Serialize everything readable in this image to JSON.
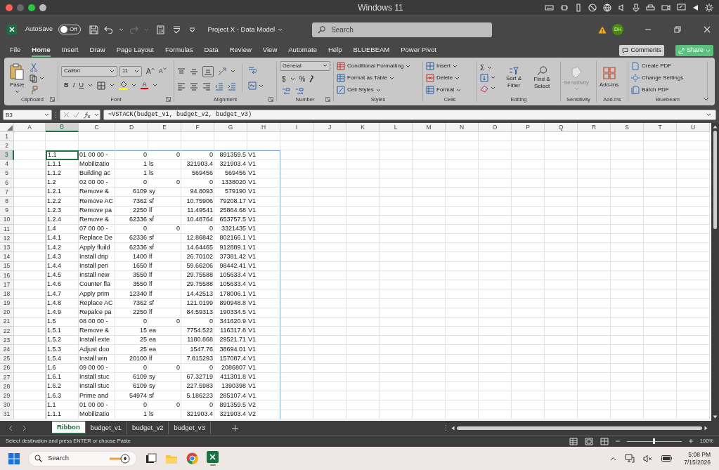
{
  "mac_bar": {
    "title": "Windows 11"
  },
  "title_bar": {
    "autosave_label": "AutoSave",
    "autosave_toggle": {
      "label": "Off",
      "on": false
    },
    "document_title": "Project X - Data Model",
    "search": {
      "placeholder": "Search"
    },
    "avatar": "DH"
  },
  "menu_tabs": [
    {
      "label": "File",
      "selected": false
    },
    {
      "label": "Home",
      "selected": true
    },
    {
      "label": "Insert",
      "selected": false
    },
    {
      "label": "Draw",
      "selected": false
    },
    {
      "label": "Page Layout",
      "selected": false
    },
    {
      "label": "Formulas",
      "selected": false
    },
    {
      "label": "Data",
      "selected": false
    },
    {
      "label": "Review",
      "selected": false
    },
    {
      "label": "View",
      "selected": false
    },
    {
      "label": "Automate",
      "selected": false
    },
    {
      "label": "Help",
      "selected": false
    },
    {
      "label": "BLUEBEAM",
      "selected": false
    },
    {
      "label": "Power Pivot",
      "selected": false
    }
  ],
  "comments_button": "Comments",
  "share_button": "Share",
  "ribbon": {
    "clipboard": {
      "paste": "Paste",
      "group": "Clipboard"
    },
    "font": {
      "font_name": "Calibri",
      "font_size": "11",
      "grow": "A",
      "shrink": "A",
      "bold": "B",
      "italic": "I",
      "underline": "U",
      "font_color": "A",
      "group": "Font"
    },
    "alignment": {
      "group": "Alignment"
    },
    "number": {
      "format": "General",
      "currency": "$",
      "percent": "%",
      "group": "Number"
    },
    "styles": {
      "items": [
        "Conditional Formatting",
        "Format as Table",
        "Cell Styles"
      ],
      "group": "Styles"
    },
    "cells": {
      "items": [
        "Insert",
        "Delete",
        "Format"
      ],
      "group": "Cells"
    },
    "editing": {
      "autosum": "Σ",
      "sort": "Sort & Filter",
      "find": "Find & Select",
      "group": "Editing"
    },
    "sensitivity": {
      "label": "Sensitivity",
      "disabled": true,
      "group": "Sensitivity"
    },
    "addins": {
      "label": "Add-ins",
      "group": "Add-ins"
    },
    "bluebeam": {
      "items": [
        "Create PDF",
        "Change Settings",
        "Batch PDF"
      ],
      "group": "Bluebeam"
    }
  },
  "formula_bar": {
    "name_box": "B3",
    "formula": "=VSTACK(budget_v1, budget_v2, budget_v3)"
  },
  "sheet": {
    "columns": [
      {
        "label": "A",
        "selected": false
      },
      {
        "label": "B",
        "selected": true
      },
      {
        "label": "C",
        "selected": false
      },
      {
        "label": "D",
        "selected": false
      },
      {
        "label": "E",
        "selected": false
      },
      {
        "label": "F",
        "selected": false
      },
      {
        "label": "G",
        "selected": false
      },
      {
        "label": "H",
        "selected": false
      },
      {
        "label": "I",
        "selected": false
      },
      {
        "label": "J",
        "selected": false
      },
      {
        "label": "K",
        "selected": false
      },
      {
        "label": "L",
        "selected": false
      },
      {
        "label": "M",
        "selected": false
      },
      {
        "label": "N",
        "selected": false
      },
      {
        "label": "O",
        "selected": false
      },
      {
        "label": "P",
        "selected": false
      },
      {
        "label": "Q",
        "selected": false
      },
      {
        "label": "R",
        "selected": false
      },
      {
        "label": "S",
        "selected": false
      },
      {
        "label": "T",
        "selected": false
      },
      {
        "label": "U",
        "selected": false
      }
    ],
    "rows": [
      {
        "number": "1",
        "selected": false
      },
      {
        "number": "2",
        "selected": false
      },
      {
        "number": "3",
        "selected": true,
        "cells": [
          "1.1",
          "01 00 00 -",
          "0",
          "0",
          "0",
          "891359.5",
          "V1"
        ]
      },
      {
        "number": "4",
        "selected": false,
        "cells": [
          "1.1.1",
          "Mobilizatio",
          "1",
          "ls",
          "321903.4",
          "321903.4",
          "V1"
        ]
      },
      {
        "number": "5",
        "selected": false,
        "cells": [
          "1.1.2",
          "Building ac",
          "1",
          "ls",
          "569456",
          "569456",
          "V1"
        ]
      },
      {
        "number": "6",
        "selected": false,
        "cells": [
          "1.2",
          "02 00 00 -",
          "0",
          "0",
          "0",
          "1338020",
          "V1"
        ]
      },
      {
        "number": "7",
        "selected": false,
        "cells": [
          "1.2.1",
          "Remove &",
          "6109",
          "sy",
          "94.8093",
          "579190",
          "V1"
        ]
      },
      {
        "number": "8",
        "selected": false,
        "cells": [
          "1.2.2",
          "Remove AC",
          "7362",
          "sf",
          "10.75906",
          "79208.17",
          "V1"
        ]
      },
      {
        "number": "9",
        "selected": false,
        "cells": [
          "1.2.3",
          "Remove pa",
          "2250",
          "lf",
          "11.49541",
          "25864.68",
          "V1"
        ]
      },
      {
        "number": "10",
        "selected": false,
        "cells": [
          "1.2.4",
          "Remove &",
          "62336",
          "sf",
          "10.48764",
          "653757.5",
          "V1"
        ]
      },
      {
        "number": "11",
        "selected": false,
        "cells": [
          "1.4",
          "07 00 00 -",
          "0",
          "0",
          "0",
          "3321435",
          "V1"
        ]
      },
      {
        "number": "12",
        "selected": false,
        "cells": [
          "1.4.1",
          "Replace De",
          "62336",
          "sf",
          "12.86842",
          "802166.1",
          "V1"
        ]
      },
      {
        "number": "13",
        "selected": false,
        "cells": [
          "1.4.2",
          "Apply fluild",
          "62336",
          "sf",
          "14.64465",
          "912889.1",
          "V1"
        ]
      },
      {
        "number": "14",
        "selected": false,
        "cells": [
          "1.4.3",
          "Install drip",
          "1400",
          "lf",
          "26.70102",
          "37381.42",
          "V1"
        ]
      },
      {
        "number": "15",
        "selected": false,
        "cells": [
          "1.4.4",
          "Install peri",
          "1650",
          "lf",
          "59.66206",
          "98442.41",
          "V1"
        ]
      },
      {
        "number": "16",
        "selected": false,
        "cells": [
          "1.4.5",
          "Install new",
          "3550",
          "lf",
          "29.75588",
          "105633.4",
          "V1"
        ]
      },
      {
        "number": "17",
        "selected": false,
        "cells": [
          "1.4.6",
          "Counter fla",
          "3550",
          "lf",
          "29.75588",
          "105633.4",
          "V1"
        ]
      },
      {
        "number": "18",
        "selected": false,
        "cells": [
          "1.4.7",
          "Apply prim",
          "12340",
          "lf",
          "14.42513",
          "178006.1",
          "V1"
        ]
      },
      {
        "number": "19",
        "selected": false,
        "cells": [
          "1.4.8",
          "Replace AC",
          "7362",
          "sf",
          "121.0199",
          "890948.8",
          "V1"
        ]
      },
      {
        "number": "20",
        "selected": false,
        "cells": [
          "1.4.9",
          "Repalce pa",
          "2250",
          "lf",
          "84.59313",
          "190334.5",
          "V1"
        ]
      },
      {
        "number": "21",
        "selected": false,
        "cells": [
          "1.5",
          "08 00 00 -",
          "0",
          "0",
          "0",
          "341620.9",
          "V1"
        ]
      },
      {
        "number": "22",
        "selected": false,
        "cells": [
          "1.5.1",
          "Remove &",
          "15",
          "ea",
          "7754.522",
          "116317.8",
          "V1"
        ]
      },
      {
        "number": "23",
        "selected": false,
        "cells": [
          "1.5.2",
          "Install exte",
          "25",
          "ea",
          "1180.868",
          "29521.71",
          "V1"
        ]
      },
      {
        "number": "24",
        "selected": false,
        "cells": [
          "1.5.3",
          "Adjust doo",
          "25",
          "ea",
          "1547.76",
          "38694.01",
          "V1"
        ]
      },
      {
        "number": "25",
        "selected": false,
        "cells": [
          "1.5.4",
          "Install win",
          "20100",
          "lf",
          "7.815293",
          "157087.4",
          "V1"
        ]
      },
      {
        "number": "26",
        "selected": false,
        "cells": [
          "1.6",
          "09 00 00 -",
          "0",
          "0",
          "0",
          "2086807",
          "V1"
        ]
      },
      {
        "number": "27",
        "selected": false,
        "cells": [
          "1.6.1",
          "Install stuc",
          "6109",
          "sy",
          "67.32719",
          "411301.8",
          "V1"
        ]
      },
      {
        "number": "28",
        "selected": false,
        "cells": [
          "1.6.2",
          "Install stuc",
          "6109",
          "sy",
          "227.5983",
          "1390398",
          "V1"
        ]
      },
      {
        "number": "29",
        "selected": false,
        "cells": [
          "1.6.3",
          "Prime and",
          "54974",
          "sf",
          "5.186223",
          "285107.4",
          "V1"
        ]
      },
      {
        "number": "30",
        "selected": false,
        "cells": [
          "1.1",
          "01 00 00 -",
          "0",
          "0",
          "0",
          "891359.5",
          "V2"
        ]
      },
      {
        "number": "31",
        "selected": false,
        "cells": [
          "1.1.1",
          "Mobilizatio",
          "1",
          "ls",
          "321903.4",
          "321903.4",
          "V2"
        ]
      }
    ]
  },
  "sheet_tabs": [
    {
      "label": "Ribbon",
      "selected": true
    },
    {
      "label": "budget_v1",
      "selected": false
    },
    {
      "label": "budget_v2",
      "selected": false
    },
    {
      "label": "budget_v3",
      "selected": false
    }
  ],
  "status_bar": {
    "message": "Select destination and press ENTER or choose Paste",
    "zoom_slider": {
      "level": 0.5
    },
    "zoom": "100%"
  },
  "taskbar": {
    "search": {
      "placeholder": "Search"
    },
    "time": "5:08 PM",
    "date": "7/15/2026"
  }
}
